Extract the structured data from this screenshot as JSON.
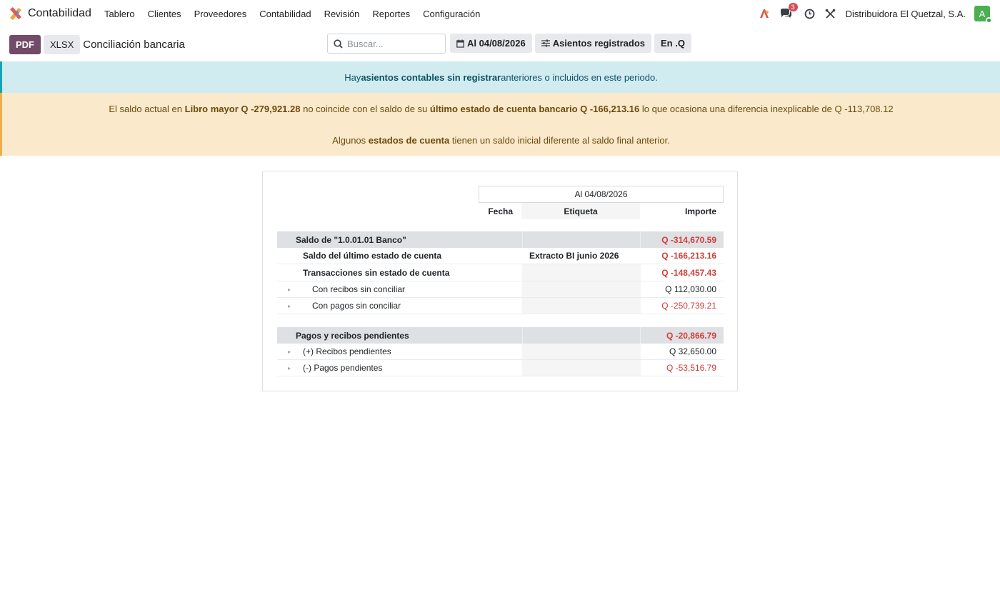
{
  "navbar": {
    "app_name": "Contabilidad",
    "menu": [
      "Tablero",
      "Clientes",
      "Proveedores",
      "Contabilidad",
      "Revisión",
      "Reportes",
      "Configuración"
    ],
    "messages_badge": "3",
    "company": "Distribuidora El Quetzal, S.A.",
    "avatar_letter": "A"
  },
  "controls": {
    "pdf_label": "PDF",
    "xlsx_label": "XLSX",
    "title": "Conciliación bancaria",
    "search_placeholder": "Buscar...",
    "date_filter": "Al 04/08/2026",
    "entries_filter": "Asientos registrados",
    "currency_filter": "En .Q"
  },
  "alerts": {
    "info": {
      "pre": "Hay ",
      "link": "asientos contables sin registrar",
      "post": " anteriores o incluidos en este periodo."
    },
    "warning1": {
      "t1": "El saldo actual en ",
      "b1": "Libro mayor Q -279,921.28",
      "t2": " no coincide con el saldo de su ",
      "b2": "último estado de cuenta bancario Q -166,213.16",
      "t3": " lo que ocasiona una diferencia inexplicable de Q -113,708.12"
    },
    "warning2": {
      "t1": "Algunos ",
      "b1": "estados de cuenta",
      "t2": " tienen un saldo inicial diferente al saldo final anterior."
    }
  },
  "report": {
    "period_header": "Al 04/08/2026",
    "col_fecha": "Fecha",
    "col_etiqueta": "Etiqueta",
    "col_importe": "Importe",
    "rows": [
      {
        "label": "Saldo de \"1.0.01.01 Banco\"",
        "etiqueta": "",
        "amount": "Q -314,670.59"
      },
      {
        "label": "Saldo del último estado de cuenta",
        "etiqueta": "Extracto BI junio 2026",
        "amount": "Q -166,213.16"
      },
      {
        "label": "Transacciones sin estado de cuenta",
        "etiqueta": "",
        "amount": "Q -148,457.43"
      },
      {
        "label": "Con recibos sin conciliar",
        "etiqueta": "",
        "amount": "Q 112,030.00"
      },
      {
        "label": "Con pagos sin conciliar",
        "etiqueta": "",
        "amount": "Q -250,739.21"
      },
      {
        "label": "Pagos y recibos pendientes",
        "etiqueta": "",
        "amount": "Q -20,866.79"
      },
      {
        "label": "(+) Recibos pendientes",
        "etiqueta": "",
        "amount": "Q 32,650.00"
      },
      {
        "label": "(-) Pagos pendientes",
        "etiqueta": "",
        "amount": "Q -53,516.79"
      }
    ]
  },
  "colors": {
    "primary": "#714b67",
    "negative": "#d23f3a",
    "info_bg": "#d1ecf1",
    "warning_bg": "#fbe9cb"
  }
}
